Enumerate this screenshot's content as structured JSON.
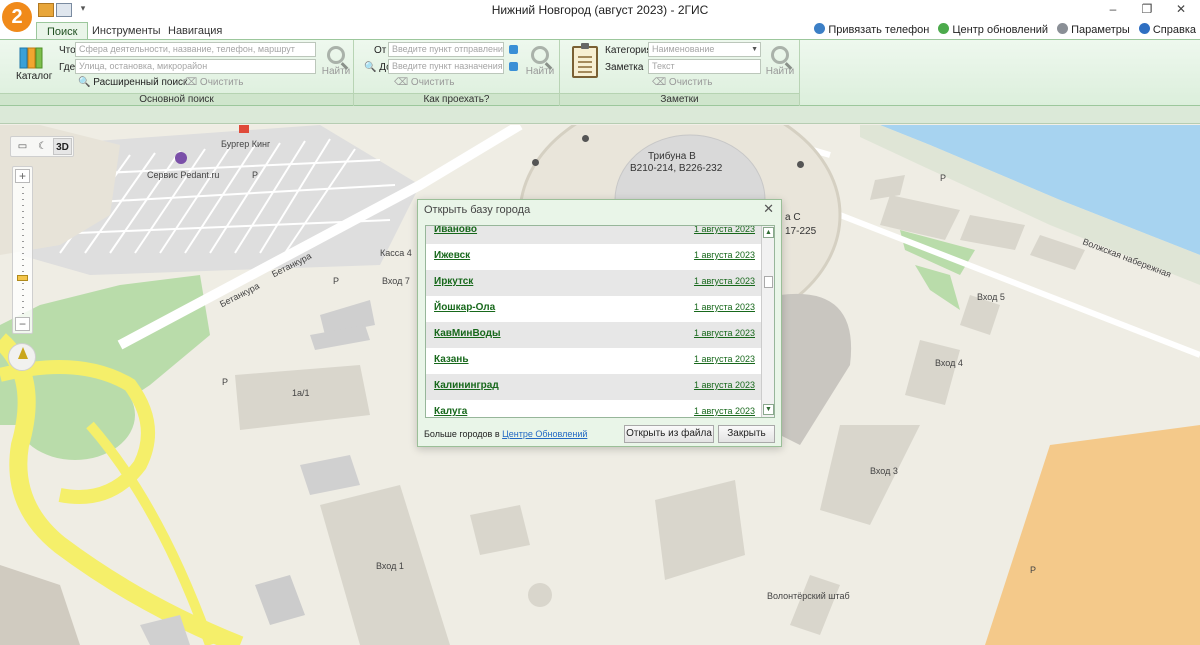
{
  "window": {
    "title": "Нижний Новгород (август 2023) - 2ГИС",
    "app_logo": "2",
    "controls": [
      "–",
      "❐",
      "✕"
    ]
  },
  "ribbon": {
    "tabs": [
      "Поиск",
      "Инструменты",
      "Навигация"
    ],
    "links": [
      "Привязать телефон",
      "Центр обновлений",
      "Параметры",
      "Справка"
    ],
    "main_search": {
      "catalog_label": "Каталог",
      "what_label": "Что",
      "what_placeholder": "Сфера деятельности, название, телефон, маршрут",
      "where_label": "Где",
      "where_placeholder": "Улица, остановка, микрорайон",
      "find_label": "Найти",
      "advanced_label": "Расширенный поиск",
      "clear_label": "Очистить",
      "group_label": "Основной поиск"
    },
    "route": {
      "from_label": "От",
      "from_placeholder": "Введите пункт отправления",
      "to_label": "До",
      "to_placeholder": "Введите пункт назначения",
      "find_label": "Найти",
      "clear_label": "Очистить",
      "group_label": "Как проехать?"
    },
    "notes": {
      "category_label": "Категория",
      "category_placeholder": "Наименование",
      "note_label": "Заметка",
      "note_placeholder": "Текст",
      "find_label": "Найти",
      "clear_label": "Очистить",
      "group_label": "Заметки"
    }
  },
  "map": {
    "tools": {
      "ruler": "ruler-icon",
      "mode": "moon-icon",
      "view3d": "3D"
    },
    "zoom_in": "+",
    "zoom_out": "−",
    "labels": {
      "burger": "Бургер Кинг",
      "pedant": "Сервис Pedant.ru",
      "tribune": "Трибуна B",
      "tribune_seats": "B210-214, B226-232",
      "tribune_c1": "а С",
      "tribune_c2": "17-225",
      "kassa": "Касса 4",
      "vhod7": "Вход 7",
      "vhod5": "Вход 5",
      "vhod4": "Вход 4",
      "vhod3": "Вход 3",
      "vhod1": "Вход 1",
      "betankura1": "Бетанкура",
      "betankura2": "Бетанкура",
      "volzhskaya": "Волжская набережная",
      "building": "1а/1",
      "volunteer": "Волонтёрский штаб",
      "p1": "P",
      "p2": "P",
      "p3": "P",
      "p4": "P",
      "p5": "P"
    }
  },
  "dialog": {
    "title": "Открыть базу города",
    "cities": [
      {
        "name": "Иваново",
        "date": "1 августа 2023"
      },
      {
        "name": "Ижевск",
        "date": "1 августа 2023"
      },
      {
        "name": "Иркутск",
        "date": "1 августа 2023"
      },
      {
        "name": "Йошкар-Ола",
        "date": "1 августа 2023"
      },
      {
        "name": "КавМинВоды",
        "date": "1 августа 2023"
      },
      {
        "name": "Казань",
        "date": "1 августа 2023"
      },
      {
        "name": "Калининград",
        "date": "1 августа 2023"
      },
      {
        "name": "Калуга",
        "date": "1 августа 2023"
      }
    ],
    "more_prefix": "Больше городов в",
    "more_link": "Центре Обновлений",
    "open_file": "Открыть из файла",
    "close": "Закрыть"
  },
  "colors": {
    "ribbon_bg": "#dcefdc",
    "accent_green": "#17681b",
    "water": "#a7d3f0",
    "road_yellow": "#f5ef6a",
    "park_green": "#b9dcaa",
    "logo_orange": "#f08a1a"
  }
}
